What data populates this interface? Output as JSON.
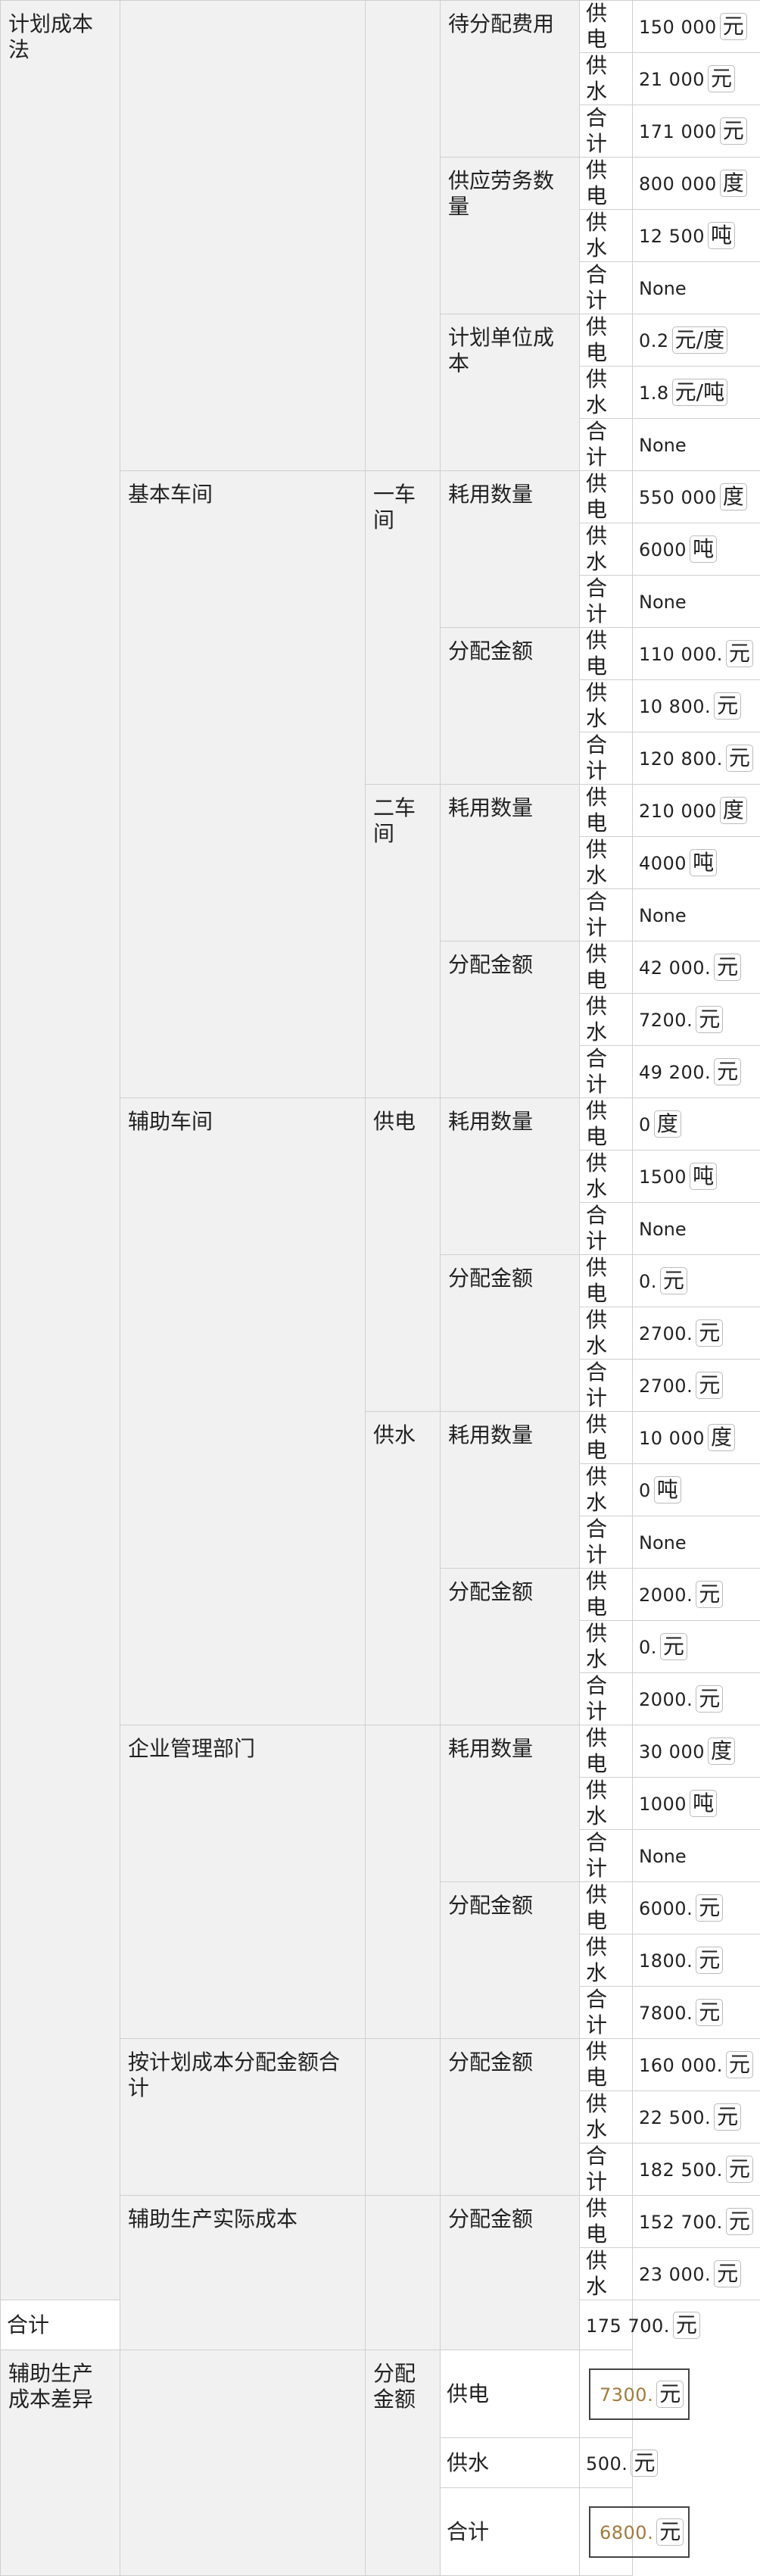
{
  "labels": {
    "method": "计划成本法",
    "pending_cost": "待分配费用",
    "labor_qty": "供应劳务数量",
    "unit_cost": "计划单位成本",
    "basic_workshop": "基本车间",
    "ws1": "一车间",
    "ws2": "二车间",
    "consumption": "耗用数量",
    "allocated": "分配金额",
    "aux_workshop": "辅助车间",
    "power": "供电",
    "water": "供水",
    "total": "合计",
    "mgmt": "企业管理部门",
    "planned_total": "按计划成本分配金额合计",
    "actual_cost": "辅助生产实际成本",
    "variance": "辅助生产成本差异"
  },
  "units": {
    "yuan": "元",
    "du": "度",
    "dun": "吨",
    "yuan_per_du": "元/度",
    "yuan_per_dun": "元/吨",
    "none": "None"
  },
  "values": {
    "pending": {
      "power": "150 000",
      "water": "21 000",
      "total": "171 000"
    },
    "labor": {
      "power": "800 000",
      "water": "12 500"
    },
    "unitcost": {
      "power": "0.2",
      "water": "1.8"
    },
    "ws1_qty": {
      "power": "550 000",
      "water": "6000"
    },
    "ws1_amt": {
      "power": "110 000.",
      "water": "10 800.",
      "total": "120 800."
    },
    "ws2_qty": {
      "power": "210 000",
      "water": "4000"
    },
    "ws2_amt": {
      "power": "42 000.",
      "water": "7200.",
      "total": "49 200."
    },
    "auxp_qty": {
      "power": "0",
      "water": "1500"
    },
    "auxp_amt": {
      "power": "0.",
      "water": "2700.",
      "total": "2700."
    },
    "auxw_qty": {
      "power": "10 000",
      "water": "0"
    },
    "auxw_amt": {
      "power": "2000.",
      "water": "0.",
      "total": "2000."
    },
    "mgmt_qty": {
      "power": "30 000",
      "water": "1000"
    },
    "mgmt_amt": {
      "power": "6000.",
      "water": "1800.",
      "total": "7800."
    },
    "planned": {
      "power": "160 000.",
      "water": "22 500.",
      "total": "182 500."
    },
    "actual": {
      "power": "152 700.",
      "water": "23 000.",
      "total": "175 700."
    },
    "variance": {
      "power": "7300.",
      "water": "500.",
      "total": "6800."
    }
  }
}
